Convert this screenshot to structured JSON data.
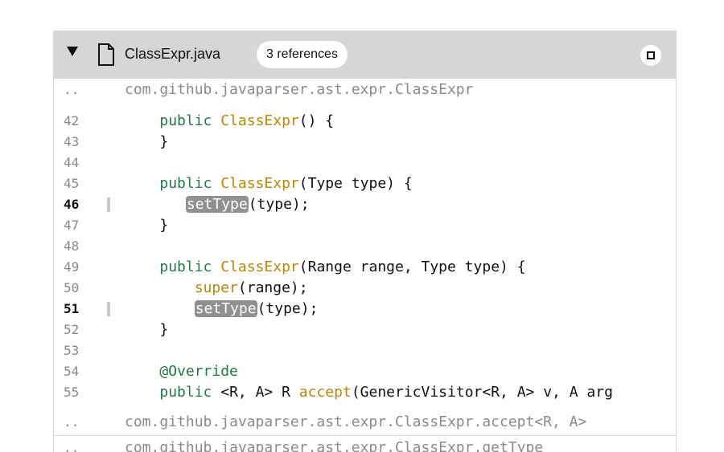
{
  "header": {
    "file_name": "ClassExpr.java",
    "references_badge": "3 references"
  },
  "colors": {
    "header_bg": "#d6d6d6",
    "keyword": "#1e7a4a",
    "method": "#b8860b",
    "highlight": "#909090"
  },
  "icons": {
    "toggle": "triangle-down-icon",
    "file": "file-icon",
    "collapse": "square-icon"
  },
  "rows": {
    "path_top": {
      "gutter": "..",
      "text": "com.github.javaparser.ast.expr.ClassExpr"
    },
    "l42": {
      "num": "42",
      "kw": "public",
      "fn": "ClassExpr",
      "rest": "() {"
    },
    "l43": {
      "num": "43",
      "text": "}"
    },
    "l44": {
      "num": "44"
    },
    "l45": {
      "num": "45",
      "kw": "public",
      "fn": "ClassExpr",
      "rest": "(Type type) {"
    },
    "l46": {
      "num": "46",
      "hl": "setType",
      "rest": "(type);"
    },
    "l47": {
      "num": "47",
      "text": "}"
    },
    "l48": {
      "num": "48"
    },
    "l49": {
      "num": "49",
      "kw": "public",
      "fn": "ClassExpr",
      "rest": "(Range range, Type type) {"
    },
    "l50": {
      "num": "50",
      "fn": "super",
      "rest": "(range);"
    },
    "l51": {
      "num": "51",
      "hl": "setType",
      "rest": "(type);"
    },
    "l52": {
      "num": "52",
      "text": "}"
    },
    "l53": {
      "num": "53"
    },
    "l54": {
      "num": "54",
      "ann": "@Override"
    },
    "l55": {
      "num": "55",
      "kw": "public",
      "pre": "<R, A> R ",
      "fn": "accept",
      "rest": "(GenericVisitor<R, A> v, A arg"
    },
    "path_accept": {
      "gutter": "..",
      "text": "com.github.javaparser.ast.expr.ClassExpr.accept<R, A>"
    },
    "path_gettype": {
      "gutter": "..",
      "text": "com.github.javaparser.ast.expr.ClassExpr.getType"
    }
  }
}
